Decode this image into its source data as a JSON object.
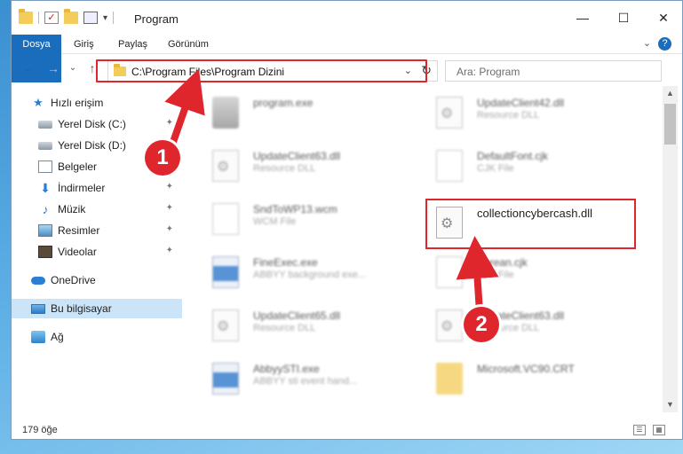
{
  "window": {
    "title": "Program",
    "minimize": "—",
    "maximize": "☐",
    "close": "✕"
  },
  "ribbon": {
    "tabs": [
      "Dosya",
      "Giriş",
      "Paylaş",
      "Görünüm"
    ],
    "expand": "⌄",
    "help": "?"
  },
  "navbar": {
    "back": "←",
    "forward": "→",
    "recent": "⌄",
    "up": "↑",
    "address": "C:\\Program Files\\Program Dizini",
    "address_dropdown": "⌄",
    "refresh": "↻",
    "search_placeholder": "Ara: Program"
  },
  "sidebar": {
    "items": [
      {
        "label": "Hızlı erişim",
        "icon": "star-icon"
      },
      {
        "label": "Yerel Disk (C:)",
        "icon": "disk-icon",
        "pin": "✦"
      },
      {
        "label": "Yerel Disk (D:)",
        "icon": "disk-icon",
        "pin": "✦"
      },
      {
        "label": "Belgeler",
        "icon": "document-icon",
        "pin": "✦"
      },
      {
        "label": "İndirmeler",
        "icon": "download-icon",
        "pin": "✦"
      },
      {
        "label": "Müzik",
        "icon": "music-icon",
        "pin": "✦"
      },
      {
        "label": "Resimler",
        "icon": "pictures-icon",
        "pin": "✦"
      },
      {
        "label": "Videolar",
        "icon": "video-icon",
        "pin": "✦"
      },
      {
        "label": "OneDrive",
        "icon": "cloud-icon"
      },
      {
        "label": "Bu bilgisayar",
        "icon": "computer-icon"
      },
      {
        "label": "Ağ",
        "icon": "network-icon"
      }
    ]
  },
  "files": [
    {
      "name": "program.exe",
      "type": "",
      "icon": "exe-icon"
    },
    {
      "name": "UpdateClient42.dll",
      "type": "Resource DLL",
      "icon": "dll-icon"
    },
    {
      "name": "UpdateClient63.dll",
      "type": "Resource DLL",
      "icon": "dll-icon"
    },
    {
      "name": "DefaultFont.cjk",
      "type": "CJK File",
      "icon": "page-icon"
    },
    {
      "name": "SndToWP13.wcm",
      "type": "WCM File",
      "icon": "page-icon"
    },
    {
      "name": "collectioncybercash.dll",
      "type": "",
      "icon": "dll-icon"
    },
    {
      "name": "FineExec.exe",
      "type": "ABBYY background exe...",
      "icon": "app-icon"
    },
    {
      "name": "Korean.cjk",
      "type": "CJK File",
      "icon": "page-icon"
    },
    {
      "name": "UpdateClient65.dll",
      "type": "Resource DLL",
      "icon": "dll-icon"
    },
    {
      "name": "UpdateClient63.dll",
      "type": "Resource DLL",
      "icon": "dll-icon"
    },
    {
      "name": "AbbyySTI.exe",
      "type": "ABBYY sti event hand...",
      "icon": "app-icon"
    },
    {
      "name": "Microsoft.VC90.CRT",
      "type": "",
      "icon": "folder-icon"
    }
  ],
  "statusbar": {
    "count": "179 öğe",
    "details_view": "☰",
    "icons_view": "▦"
  },
  "annotations": {
    "badge1": "1",
    "badge2": "2"
  },
  "colors": {
    "accent": "#1a6dbd",
    "highlight": "#e0262d",
    "selection": "#cce4f7"
  }
}
